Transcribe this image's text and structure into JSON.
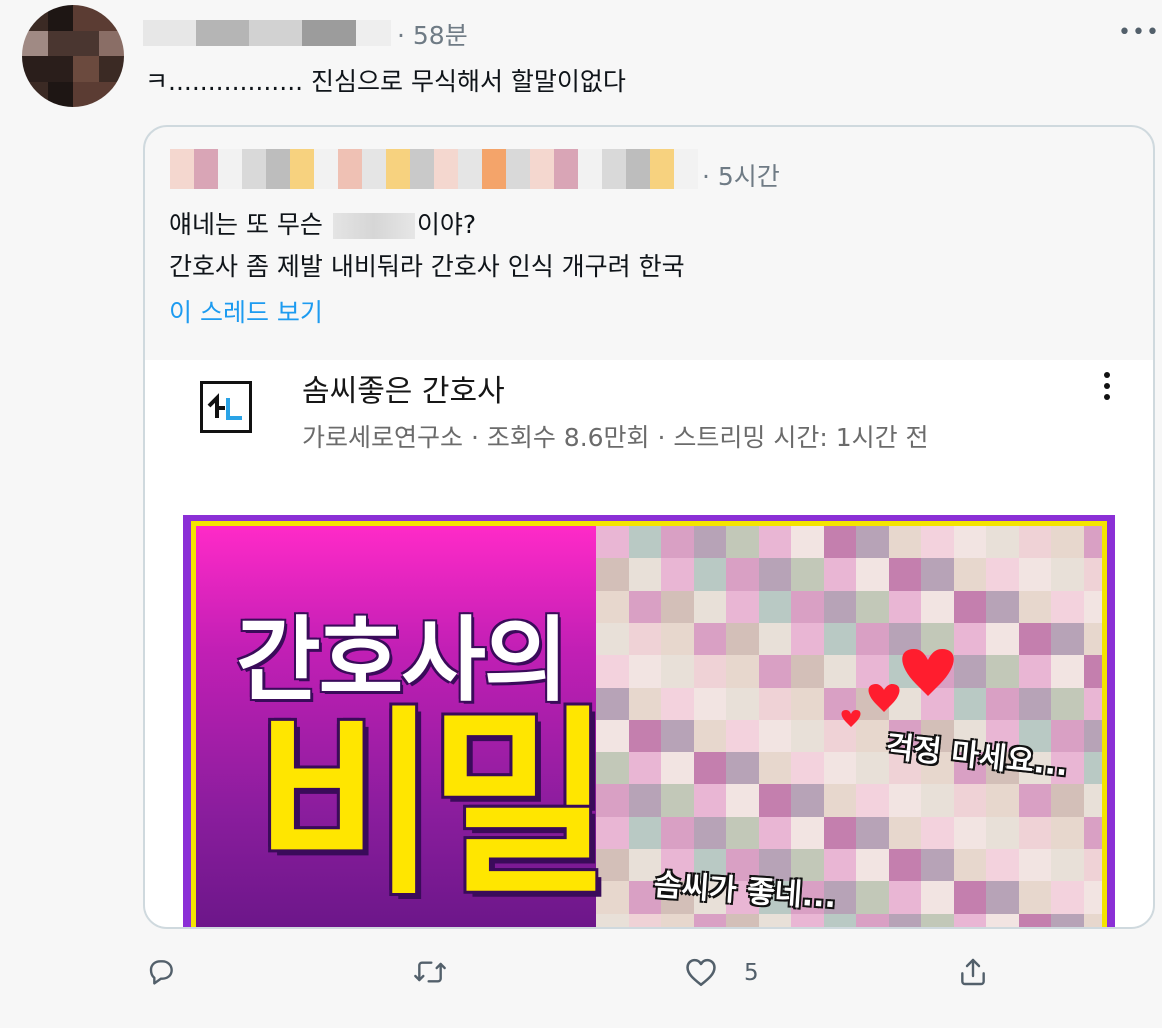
{
  "tweet": {
    "time": "· 58분",
    "text": "ㅋ................. 진심으로 무식해서 할말이없다"
  },
  "quoted": {
    "time": "· 5시간",
    "line1_pre": "얘네는 또 무슨 ",
    "line1_post": "이야?",
    "line2": "간호사 좀 제발 내비둬라 간호사 인식 개구려 한국",
    "show_thread": "이 스레드 보기",
    "video": {
      "title": "솜씨좋은 간호사",
      "meta": "가로세로연구소 · 조회수 8.6만회 · 스트리밍 시간: 1시간 전",
      "thumbnail": {
        "title_small": "간호사의",
        "title_big": "비밀",
        "caption_1": "걱정 마세요...",
        "caption_2": "솜씨가 좋네..."
      }
    }
  },
  "actions": {
    "like_count": "5"
  },
  "colors": {
    "link": "#1d9bf0",
    "muted": "#6f7b85",
    "thumb_border": "#f4e400",
    "thumb_frame": "#8b2fd6"
  }
}
